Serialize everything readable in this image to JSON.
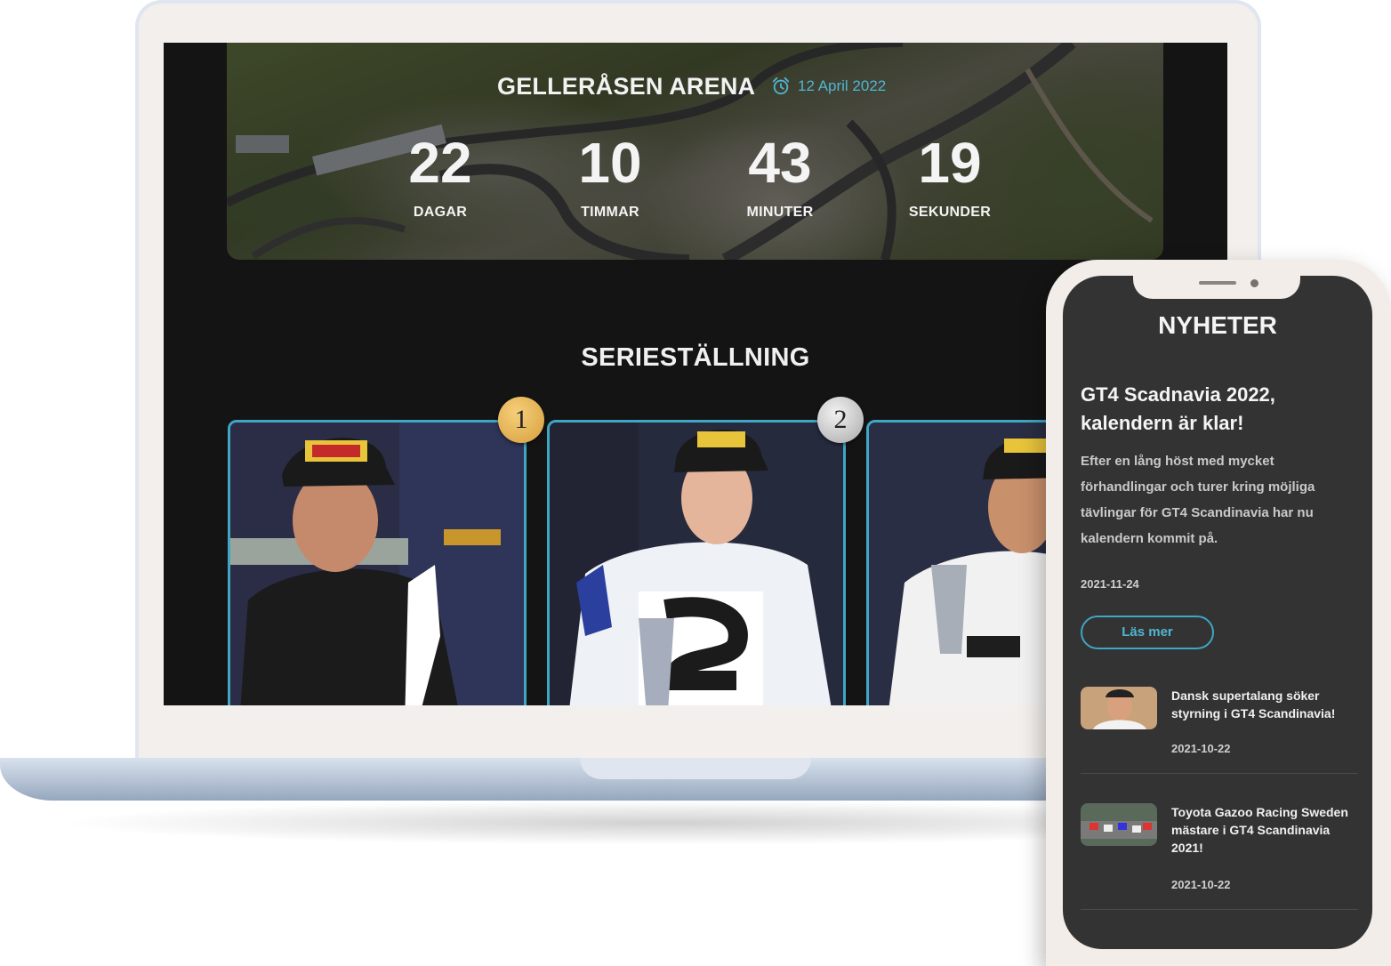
{
  "hero": {
    "venue": "GELLERÅSEN ARENA",
    "date": "12 April 2022",
    "countdown": [
      {
        "value": "22",
        "label": "DAGAR"
      },
      {
        "value": "10",
        "label": "TIMMAR"
      },
      {
        "value": "43",
        "label": "MINUTER"
      },
      {
        "value": "19",
        "label": "SEKUNDER"
      }
    ]
  },
  "standings": {
    "title": "SERIESTÄLLNING",
    "ranks": [
      "1",
      "2"
    ]
  },
  "phone": {
    "section_title": "NYHETER",
    "featured": {
      "headline": "GT4 Scadnavia 2022, kalendern är klar!",
      "body": "Efter en lång höst med mycket förhandlingar och turer kring möjliga tävlingar för GT4 Scandinavia har nu kalendern kommit på.",
      "date": "2021-11-24",
      "button": "Läs mer"
    },
    "news": [
      {
        "title": "Dansk supertalang söker styrning i GT4 Scandinavia!",
        "date": "2021-10-22"
      },
      {
        "title": "Toyota Gazoo Racing Sweden mästare i GT4 Scandinavia 2021!",
        "date": "2021-10-22"
      }
    ]
  },
  "colors": {
    "accent": "#3fa6c4",
    "background": "#141414",
    "phone_background": "#333333",
    "gold": "#e2ad4e",
    "silver": "#c8c8c8"
  }
}
